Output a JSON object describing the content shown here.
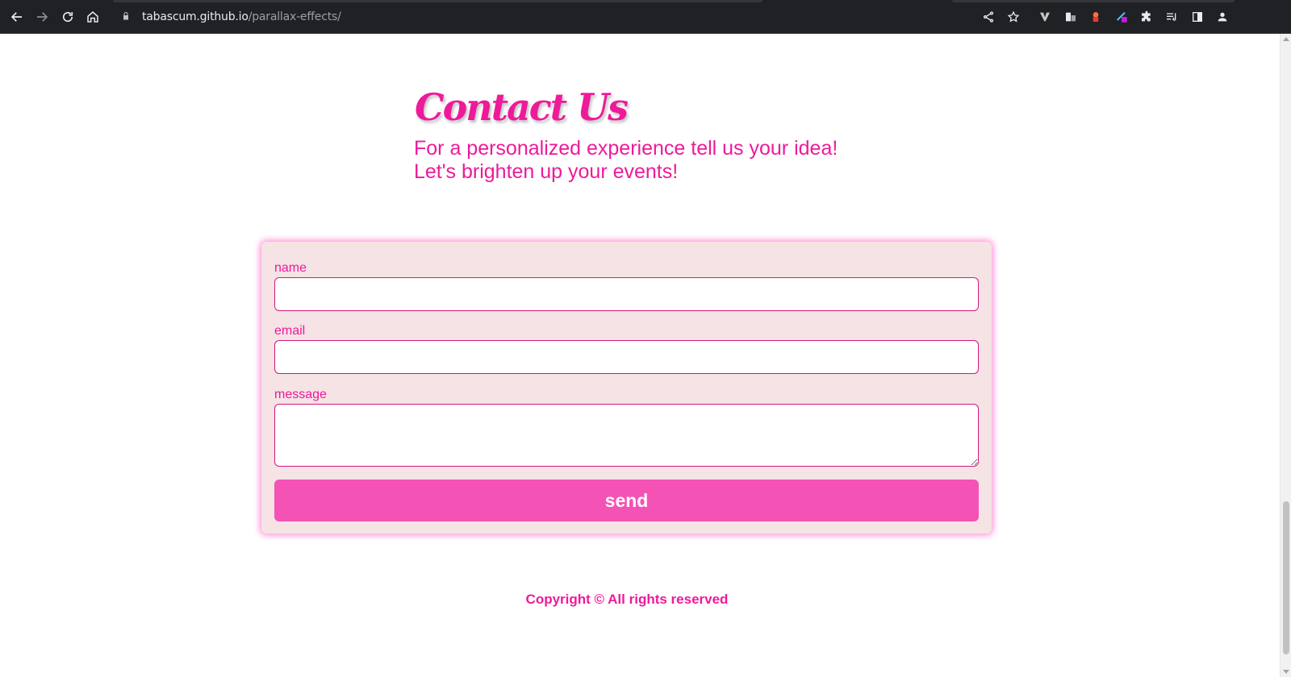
{
  "browser": {
    "url_host": "tabascum.github.io",
    "url_path": "/parallax-effects/",
    "nav_icons": [
      "back-arrow-icon",
      "forward-arrow-icon",
      "reload-icon",
      "home-icon"
    ],
    "toolbar_icons": [
      "share-icon",
      "star-icon",
      "v-extension-icon",
      "translate-extension-icon",
      "red-extension-icon",
      "colorful-extension-icon",
      "puzzle-extensions-icon",
      "reading-list-icon",
      "side-panel-icon",
      "profile-icon"
    ]
  },
  "contact": {
    "title": "Contact Us",
    "subtitle_line1": "For a personalized experience tell us your idea!",
    "subtitle_line2": "Let's brighten up your events!"
  },
  "form": {
    "name_label": "name",
    "name_value": "",
    "email_label": "email",
    "email_value": "",
    "message_label": "message",
    "message_value": "",
    "send_label": "send"
  },
  "footer": {
    "copyright": "Copyright © All rights reserved"
  },
  "colors": {
    "accent_pink": "#ee1a9a",
    "button_pink": "#f552b5",
    "card_bg": "#f5e3e5",
    "chrome_bg": "#202124"
  }
}
